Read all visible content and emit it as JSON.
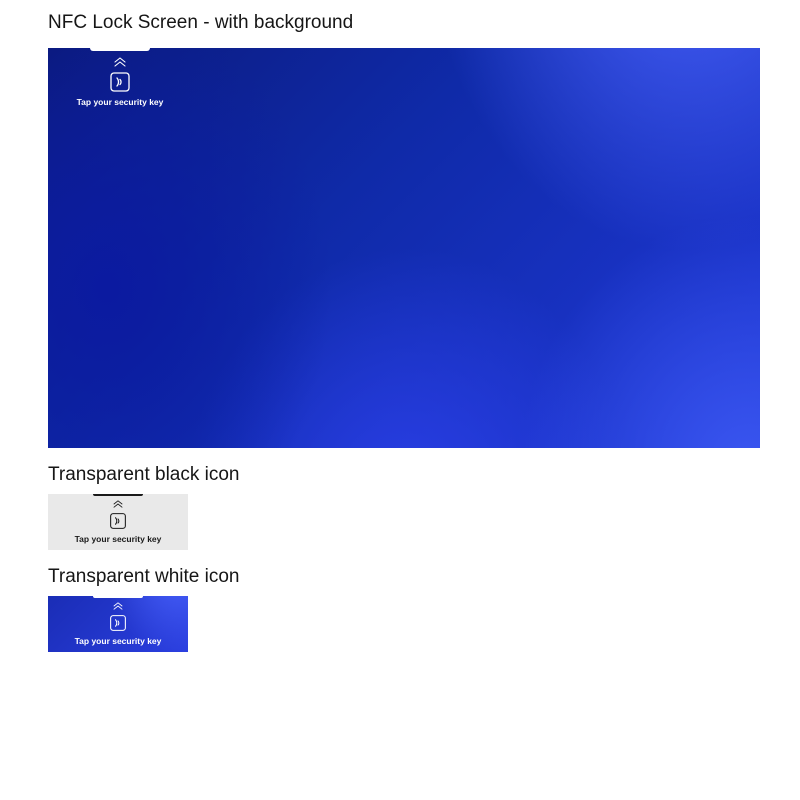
{
  "sections": {
    "main": {
      "title": "NFC Lock Screen - with background"
    },
    "black": {
      "title": "Transparent black icon"
    },
    "white": {
      "title": "Transparent white icon"
    }
  },
  "overlay": {
    "caption": "Tap your security key",
    "icons": {
      "chevron": "chevrons-up-icon",
      "nfc": "nfc-card-icon"
    }
  },
  "colors": {
    "white": "#ffffff",
    "black": "#1a1a1a",
    "bg_blue_dark": "#0b1a7d",
    "bg_blue_light": "#4a63ff",
    "thumb_light": "#e9e9e9"
  }
}
